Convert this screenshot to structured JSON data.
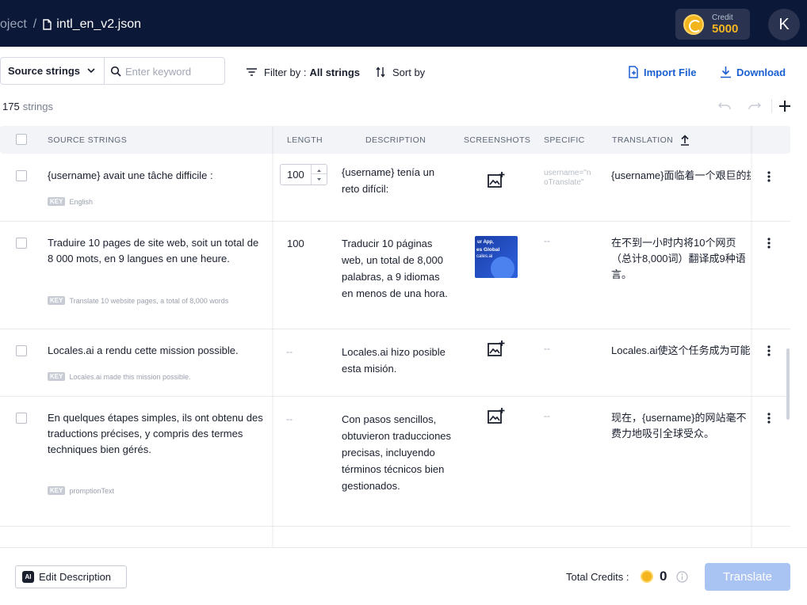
{
  "header": {
    "breadcrumb_project": "oject",
    "breadcrumb_sep": "/",
    "file_name": "intl_en_v2.json",
    "credit_label": "Credit",
    "credit_value": "5000",
    "avatar_initial": "K"
  },
  "toolbar": {
    "source_select": "Source strings",
    "search_placeholder": "Enter keyword",
    "filter_label": "Filter by :",
    "filter_value": "All strings",
    "sort_label": "Sort by",
    "import_label": "Import File",
    "download_label": "Download"
  },
  "summary": {
    "count": "175",
    "count_word": "strings"
  },
  "table": {
    "headers": {
      "source": "SOURCE STRINGS",
      "length": "LENGTH",
      "description": "DESCRIPTION",
      "screenshots": "SCREENSHOTS",
      "specific": "SPECIFIC",
      "translation": "TRANSLATION"
    },
    "rows": [
      {
        "source": "{username} avait une tâche difficile :",
        "key_tag": "KEY",
        "key": "English",
        "length": "100",
        "description": "{username} tenía un reto difícil:",
        "specific": "username=\"noTranslate\"",
        "translation": "{username}面临着一个艰巨的挑战："
      },
      {
        "source": "Traduire 10 pages de site web, soit un total de 8 000 mots, en 9 langues en une heure.",
        "key_tag": "KEY",
        "key": "Translate 10 website pages, a total of 8,000 words",
        "length": "100",
        "description": "Traducir 10 páginas web, un total de 8,000 palabras, a 9 idiomas en menos de una hora.",
        "specific": "--",
        "translation": "在不到一小时内将10个网页（总计8,000词）翻译成9种语言。",
        "thumb_line1": "ur App,",
        "thumb_line2": "es Global",
        "thumb_line3": "cales.ai"
      },
      {
        "source": "Locales.ai a rendu cette mission possible.",
        "key_tag": "KEY",
        "key": "Locales.ai made this mission possible.",
        "length": "--",
        "description": "Locales.ai hizo posible esta misión.",
        "specific": "--",
        "translation": "Locales.ai使这个任务成为可能。"
      },
      {
        "source": "En quelques étapes simples, ils ont obtenu des traductions précises, y compris des termes techniques bien gérés.",
        "key_tag": "KEY",
        "key": "promptionText",
        "length": "--",
        "description": "Con pasos sencillos, obtuvieron traducciones precisas, incluyendo términos técnicos bien gestionados.",
        "specific": "--",
        "translation": "现在，{username}的网站毫不费力地吸引全球受众。"
      }
    ]
  },
  "footer": {
    "edit_badge": "AI",
    "edit_label": "Edit Description",
    "total_credits_label": "Total Credits :",
    "total_credits_value": "0",
    "translate_label": "Translate"
  },
  "colors": {
    "header_bg": "#0c1838",
    "accent_blue": "#1a5fd1",
    "credit_gold": "#f5b520",
    "translate_disabled": "#a9c3f2"
  }
}
